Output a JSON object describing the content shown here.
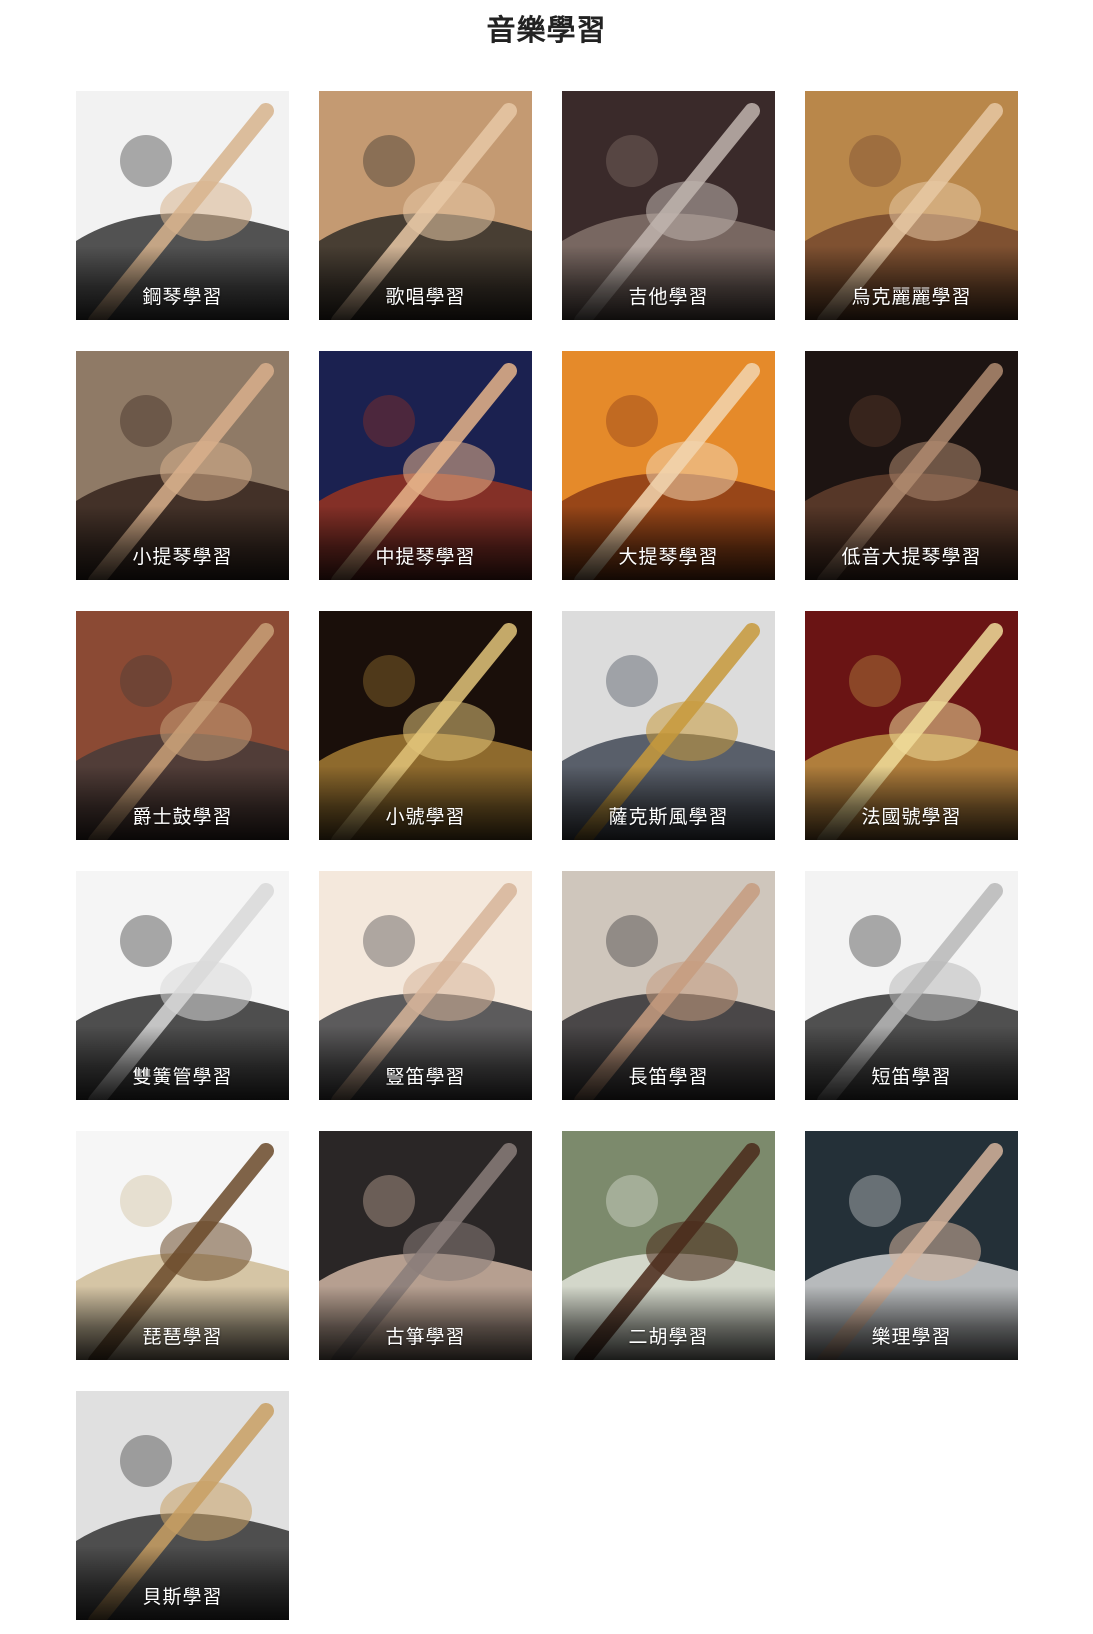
{
  "page": {
    "title": "音樂學習"
  },
  "courses": [
    {
      "label": "鋼琴學習",
      "icon": "piano-photo",
      "palette": [
        "#f2f2f2",
        "#1c1c1c",
        "#d8b48e"
      ]
    },
    {
      "label": "歌唱學習",
      "icon": "singer-photo",
      "palette": [
        "#c49a72",
        "#1f1f1f",
        "#e8c8a6"
      ]
    },
    {
      "label": "吉他學習",
      "icon": "guitar-photo",
      "palette": [
        "#3a2a2a",
        "#8e7c74",
        "#c0b4ae"
      ]
    },
    {
      "label": "烏克麗麗學習",
      "icon": "ukulele-photo",
      "palette": [
        "#b9874a",
        "#6c3f2a",
        "#e7c8a4"
      ]
    },
    {
      "label": "小提琴學習",
      "icon": "violin-photo",
      "palette": [
        "#8f7a66",
        "#2a1a14",
        "#d9b08c"
      ]
    },
    {
      "label": "中提琴學習",
      "icon": "viola-photo",
      "palette": [
        "#1b2150",
        "#a8351a",
        "#e7b48a"
      ]
    },
    {
      "label": "大提琴學習",
      "icon": "cello-photo",
      "palette": [
        "#e58a2a",
        "#7d2f13",
        "#f3d6b0"
      ]
    },
    {
      "label": "低音大提琴學習",
      "icon": "double-bass-photo",
      "palette": [
        "#1d1412",
        "#6a4330",
        "#b08b70"
      ]
    },
    {
      "label": "爵士鼓學習",
      "icon": "drum-photo",
      "palette": [
        "#8b4a34",
        "#3d3a3a",
        "#c9a078"
      ]
    },
    {
      "label": "小號學習",
      "icon": "trumpet-photo",
      "palette": [
        "#1a0f0a",
        "#b58a3a",
        "#e2c47a"
      ]
    },
    {
      "label": "薩克斯風學習",
      "icon": "saxophone-photo",
      "palette": [
        "#dcdcdc",
        "#2e3644",
        "#c89a3c"
      ]
    },
    {
      "label": "法國號學習",
      "icon": "french-horn-photo",
      "palette": [
        "#6a1414",
        "#c8a24a",
        "#f0dc9a"
      ]
    },
    {
      "label": "雙簧管學習",
      "icon": "oboe-photo",
      "palette": [
        "#f5f5f5",
        "#151515",
        "#d9d9d9"
      ]
    },
    {
      "label": "豎笛學習",
      "icon": "clarinet-photo",
      "palette": [
        "#f4e8dc",
        "#2a2c32",
        "#d7b59a"
      ]
    },
    {
      "label": "長笛學習",
      "icon": "flute-photo",
      "palette": [
        "#cfc6bc",
        "#1e1c22",
        "#c69c80"
      ]
    },
    {
      "label": "短笛學習",
      "icon": "piccolo-photo",
      "palette": [
        "#f3f3f3",
        "#1a1a1a",
        "#b9b9b9"
      ]
    },
    {
      "label": "琵琶學習",
      "icon": "pipa-photo",
      "palette": [
        "#f6f6f6",
        "#c9b48a",
        "#6b4a2a"
      ]
    },
    {
      "label": "古箏學習",
      "icon": "guzheng-photo",
      "palette": [
        "#2a2626",
        "#e6c8b4",
        "#8a7e7a"
      ]
    },
    {
      "label": "二胡學習",
      "icon": "erhu-photo",
      "palette": [
        "#7c8a6c",
        "#f0f0ea",
        "#4a2a1a"
      ]
    },
    {
      "label": "樂理學習",
      "icon": "music-theory-photo",
      "palette": [
        "#243038",
        "#e8e8e8",
        "#d6b49c"
      ]
    },
    {
      "label": "貝斯學習",
      "icon": "bass-photo",
      "palette": [
        "#e0e0e0",
        "#1e1e1e",
        "#c9a064"
      ]
    }
  ]
}
